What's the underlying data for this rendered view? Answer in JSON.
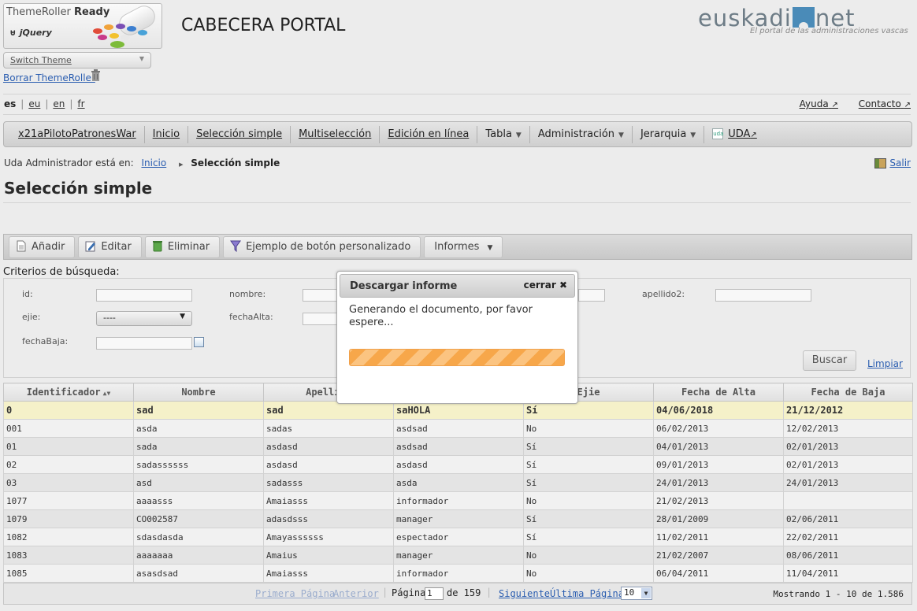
{
  "themeroller": {
    "title_plain": "ThemeRoller",
    "title_bold": "Ready",
    "jquery": "jQuery",
    "switch_theme": "Switch Theme",
    "borrar": "Borrar ThemeRoller"
  },
  "header": {
    "title": "CABECERA PORTAL",
    "brand_left": "euskadi",
    "brand_right": "net",
    "brand_sub": "El portal de las administraciones vascas"
  },
  "languages": [
    {
      "code": "es",
      "current": true
    },
    {
      "code": "eu",
      "current": false
    },
    {
      "code": "en",
      "current": false
    },
    {
      "code": "fr",
      "current": false
    }
  ],
  "toplinks": {
    "ayuda": "Ayuda",
    "contacto": "Contacto"
  },
  "menu": {
    "app": "x21aPilotoPatronesWar",
    "inicio": "Inicio",
    "seleccion_simple": "Selección simple",
    "multiseleccion": "Multiselección",
    "edicion_en_linea": "Edición en línea",
    "tabla": "Tabla",
    "administracion": "Administración",
    "jerarquia": "Jerarquia",
    "uda": "UDA",
    "uda_icon": "uda"
  },
  "breadcrumb": {
    "prefix": "Uda Administrador está en:",
    "inicio": "Inicio",
    "current": "Selección simple",
    "salir": "Salir"
  },
  "page_title": "Selección simple",
  "toolbar": {
    "anadir": "Añadir",
    "editar": "Editar",
    "eliminar": "Eliminar",
    "personalizado": "Ejemplo de botón personalizado",
    "informes": "Informes"
  },
  "filters": {
    "heading": "Criterios de búsqueda:",
    "id": "id:",
    "nombre": "nombre:",
    "apellido2": "apellido2:",
    "ejie": "ejie:",
    "ejie_value": "----",
    "fechaAlta": "fechaAlta:",
    "fechaBaja": "fechaBaja:",
    "buscar": "Buscar",
    "limpiar": "Limpiar"
  },
  "grid": {
    "columns": [
      "Identificador",
      "Nombre",
      "Apellido",
      "",
      "Ejie",
      "Fecha de Alta",
      "Fecha de Baja"
    ],
    "rows": [
      [
        "0",
        "sad",
        "sad",
        "saHOLA",
        "Sí",
        "04/06/2018",
        "21/12/2012"
      ],
      [
        "001",
        "asda",
        "sadas",
        "asdsad",
        "No",
        "06/02/2013",
        "12/02/2013"
      ],
      [
        "01",
        "sada",
        "asdasd",
        "asdsad",
        "Sí",
        "04/01/2013",
        "02/01/2013"
      ],
      [
        "02",
        "sadassssss",
        "asdasd",
        "asdasd",
        "Sí",
        "09/01/2013",
        "02/01/2013"
      ],
      [
        "03",
        "asd",
        "sadasss",
        "asda",
        "Sí",
        "24/01/2013",
        "24/01/2013"
      ],
      [
        "1077",
        "aaaasss",
        "Amaiasss",
        "informador",
        "No",
        "21/02/2013",
        ""
      ],
      [
        "1079",
        "CO002587",
        "adasdsss",
        "manager",
        "Sí",
        "28/01/2009",
        "02/06/2011"
      ],
      [
        "1082",
        "sdasdasda",
        "Amayassssss",
        "espectador",
        "Sí",
        "11/02/2011",
        "22/02/2011"
      ],
      [
        "1083",
        "aaaaaaa",
        "Amaius",
        "manager",
        "No",
        "21/02/2007",
        "08/06/2011"
      ],
      [
        "1085",
        "asasdsad",
        "Amaiasss",
        "informador",
        "No",
        "06/04/2011",
        "11/04/2011"
      ]
    ]
  },
  "pager": {
    "primera": "Primera Página",
    "anterior": "Anterior",
    "pagina": "Página",
    "page_value": "1",
    "de": "de 159",
    "siguiente": "Siguiente",
    "ultima": "Última Página",
    "rows_per_page": "10",
    "mostrando": "Mostrando 1 - 10 de 1.586"
  },
  "dialog": {
    "title": "Descargar informe",
    "close": "cerrar",
    "message": "Generando el documento, por favor espere..."
  }
}
